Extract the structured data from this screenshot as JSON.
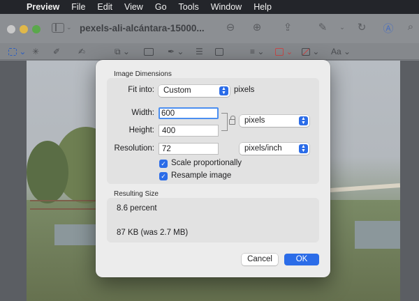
{
  "menubar": {
    "apple_icon": "apple-icon",
    "items": [
      "Preview",
      "File",
      "Edit",
      "View",
      "Go",
      "Tools",
      "Window",
      "Help"
    ]
  },
  "window": {
    "title": "pexels-ali-alcántara-15000..."
  },
  "dialog": {
    "image_dimensions_label": "Image Dimensions",
    "fit_into_label": "Fit into:",
    "fit_into_value": "Custom",
    "fit_into_unit": "pixels",
    "width_label": "Width:",
    "width_value": "600",
    "height_label": "Height:",
    "height_value": "400",
    "size_unit_value": "pixels",
    "resolution_label": "Resolution:",
    "resolution_value": "72",
    "resolution_unit_value": "pixels/inch",
    "scale_proportionally_label": "Scale proportionally",
    "scale_proportionally_checked": true,
    "resample_label": "Resample image",
    "resample_checked": true,
    "resulting_size_label": "Resulting Size",
    "percent_text": "8.6 percent",
    "size_text": "87 KB (was 2.7 MB)",
    "cancel_label": "Cancel",
    "ok_label": "OK"
  },
  "colors": {
    "accent": "#2b6ce8",
    "focus_ring": "#4b8ef0",
    "menubar_bg": "#23252a"
  }
}
